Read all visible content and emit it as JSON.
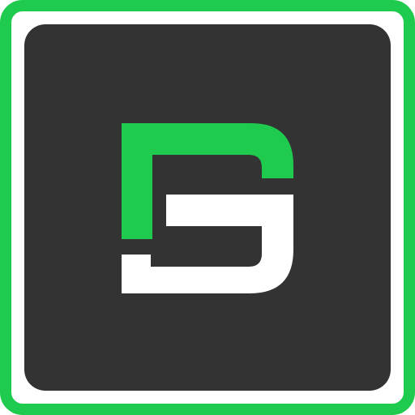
{
  "app_icon": {
    "icon_name": "dg-monogram-logo",
    "colors": {
      "frame": "#1fcb4f",
      "tile": "#333333",
      "mark_top": "#1fcb4f",
      "mark_bottom": "#ffffff",
      "background": "#ffffff"
    }
  }
}
